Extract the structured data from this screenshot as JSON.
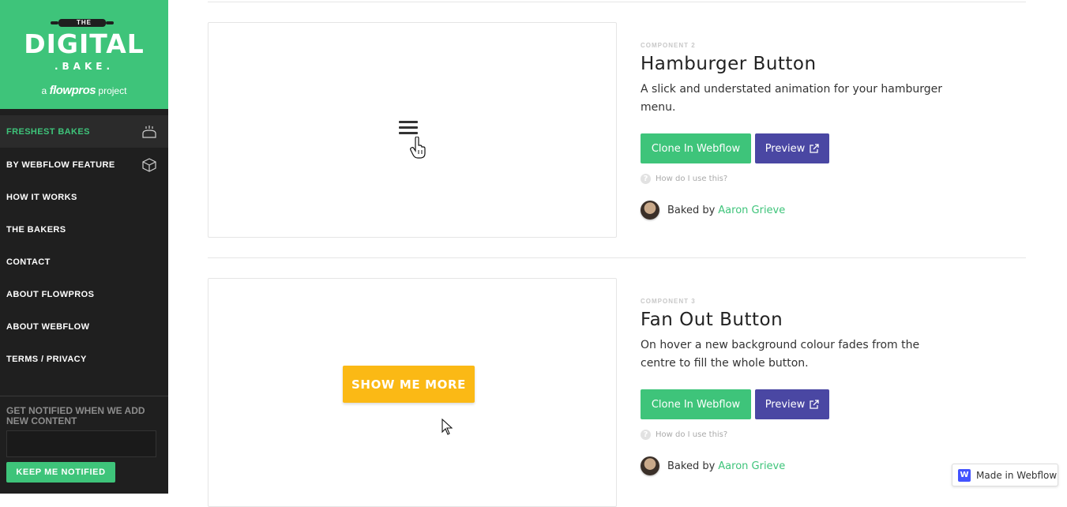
{
  "logo": {
    "the": "THE",
    "digital": "DIGITAL",
    "bake": ".BAKE.",
    "tag_prefix": "a",
    "tag_brand": "flowpros",
    "tag_suffix": "project"
  },
  "nav": {
    "items": [
      {
        "label": "FRESHEST BAKES",
        "icon": "bread-icon",
        "active": true
      },
      {
        "label": "BY WEBFLOW FEATURE",
        "icon": "box-icon"
      },
      {
        "label": "HOW IT WORKS"
      },
      {
        "label": "THE BAKERS"
      },
      {
        "label": "CONTACT"
      },
      {
        "label": "ABOUT FLOWPROS"
      },
      {
        "label": "ABOUT WEBFLOW"
      },
      {
        "label": "TERMS / PRIVACY"
      }
    ]
  },
  "notify": {
    "label": "GET NOTIFIED WHEN WE ADD NEW CONTENT",
    "input_value": "",
    "button": "KEEP ME NOTIFIED"
  },
  "components": [
    {
      "label": "COMPONENT 2",
      "title": "Hamburger Button",
      "description": "A slick and understated animation for your hamburger menu.",
      "clone": "Clone In Webflow",
      "preview": "Preview",
      "howto": "How do I use this?",
      "baked_by": "Baked by",
      "author": "Aaron Grieve"
    },
    {
      "label": "COMPONENT 3",
      "title": "Fan Out Button",
      "description": "On hover a new background colour fades from the centre to fill the whole button.",
      "clone": "Clone In Webflow",
      "preview": "Preview",
      "howto": "How do I use this?",
      "baked_by": "Baked by",
      "author": "Aaron Grieve",
      "demo_button": "SHOW ME MORE"
    }
  ],
  "badge": {
    "label": "Made in Webflow",
    "logo_letter": "W"
  },
  "colors": {
    "brand_green": "#3ec47a",
    "preview_purple": "#4a47a3",
    "sidebar_bg": "#1f1f1f",
    "demo_yellow": "#fbb915",
    "webflow_blue": "#4353ff"
  }
}
